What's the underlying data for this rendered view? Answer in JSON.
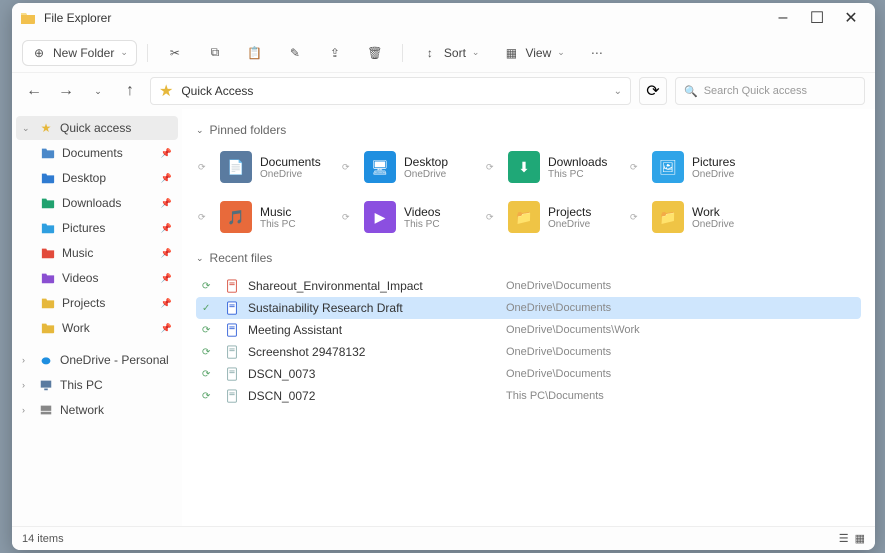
{
  "title": "File Explorer",
  "window_buttons": {
    "min": "–",
    "max": "☐",
    "close": "✕"
  },
  "toolbar": {
    "new_folder": "New Folder",
    "sort": "Sort",
    "view": "View"
  },
  "address": {
    "current": "Quick Access",
    "search_placeholder": "Search Quick access"
  },
  "sidebar": {
    "quick_access": "Quick access",
    "items": [
      {
        "label": "Documents",
        "color": "#4a88c9"
      },
      {
        "label": "Desktop",
        "color": "#2f7bd1"
      },
      {
        "label": "Downloads",
        "color": "#20a26f"
      },
      {
        "label": "Pictures",
        "color": "#2f9fe0"
      },
      {
        "label": "Music",
        "color": "#e24a3b"
      },
      {
        "label": "Videos",
        "color": "#8a4fd1"
      },
      {
        "label": "Projects",
        "color": "#e6b83c"
      },
      {
        "label": "Work",
        "color": "#e6b83c"
      }
    ],
    "lower": [
      {
        "label": "OneDrive - Personal"
      },
      {
        "label": "This PC"
      },
      {
        "label": "Network"
      }
    ]
  },
  "groups": {
    "pinned": "Pinned folders",
    "recent": "Recent files"
  },
  "pinned_folders": [
    {
      "name": "Documents",
      "loc": "OneDrive",
      "color": "#5a7ba0",
      "glyph": "📄"
    },
    {
      "name": "Desktop",
      "loc": "OneDrive",
      "color": "#1f8fe0",
      "glyph": "🖥"
    },
    {
      "name": "Downloads",
      "loc": "This PC",
      "color": "#1fa877",
      "glyph": "⬇"
    },
    {
      "name": "Pictures",
      "loc": "OneDrive",
      "color": "#2fa4e8",
      "glyph": "🖼"
    },
    {
      "name": "Music",
      "loc": "This PC",
      "color": "#e86a3b",
      "glyph": "🎵"
    },
    {
      "name": "Videos",
      "loc": "This PC",
      "color": "#8b4fe0",
      "glyph": "▶"
    },
    {
      "name": "Projects",
      "loc": "OneDrive",
      "color": "#efc445",
      "glyph": "📁"
    },
    {
      "name": "Work",
      "loc": "OneDrive",
      "color": "#efc445",
      "glyph": "📁"
    }
  ],
  "recent_files": [
    {
      "name": "Shareout_Environmental_Impact",
      "loc": "OneDrive\\Documents",
      "sync": "⟳",
      "sel": false,
      "color": "#d64b3a"
    },
    {
      "name": "Sustainability Research Draft",
      "loc": "OneDrive\\Documents",
      "sync": "✓",
      "sel": true,
      "color": "#2a5bd7"
    },
    {
      "name": "Meeting Assistant",
      "loc": "OneDrive\\Documents\\Work",
      "sync": "⟳",
      "sel": false,
      "color": "#2a5bd7"
    },
    {
      "name": "Screenshot 29478132",
      "loc": "OneDrive\\Documents",
      "sync": "⟳",
      "sel": false,
      "color": "#8aa"
    },
    {
      "name": "DSCN_0073",
      "loc": "OneDrive\\Documents",
      "sync": "⟳",
      "sel": false,
      "color": "#8aa"
    },
    {
      "name": "DSCN_0072",
      "loc": "This PC\\Documents",
      "sync": "⟳",
      "sel": false,
      "color": "#8aa"
    }
  ],
  "status": {
    "count": "14 items"
  }
}
